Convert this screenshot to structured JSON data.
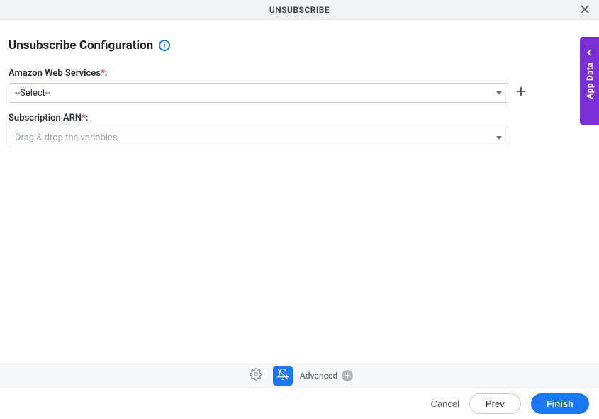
{
  "header": {
    "title": "UNSUBSCRIBE"
  },
  "page": {
    "title": "Unsubscribe Configuration"
  },
  "fields": {
    "aws": {
      "label": "Amazon Web Services",
      "required_marker": "*",
      "colon": ":",
      "value": "--Select--"
    },
    "arn": {
      "label": "Subscription ARN",
      "required_marker": "*",
      "colon": ":",
      "placeholder": "Drag & drop the variables"
    }
  },
  "sideTab": {
    "label": "App Data"
  },
  "toolbar": {
    "advanced_label": "Advanced"
  },
  "footer": {
    "cancel": "Cancel",
    "prev": "Prev",
    "finish": "Finish"
  },
  "colors": {
    "accent": "#1976f5",
    "brand_purple": "#7a2fd6",
    "required": "#e1332d"
  }
}
